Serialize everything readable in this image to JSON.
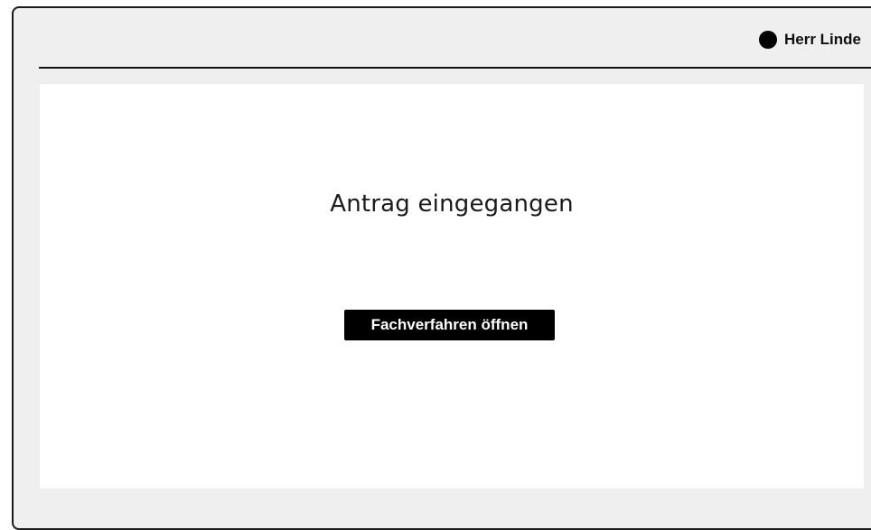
{
  "header": {
    "user_name": "Herr Linde"
  },
  "main": {
    "status_title": "Antrag eingegangen",
    "open_button_label": "Fachverfahren öffnen"
  },
  "colors": {
    "frame_background": "#efefef",
    "content_background": "#ffffff",
    "button_background": "#000000",
    "button_text": "#ffffff"
  }
}
